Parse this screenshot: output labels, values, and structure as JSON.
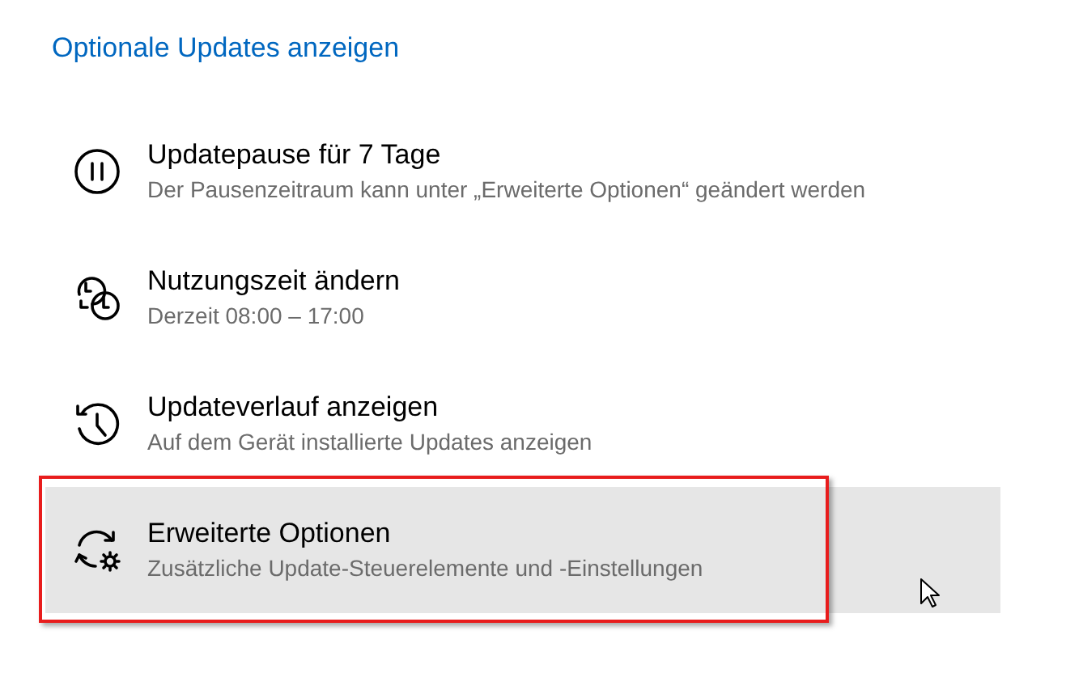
{
  "link": "Optionale Updates anzeigen",
  "items": [
    {
      "kind": "pause",
      "title": "Updatepause für 7 Tage",
      "subtitle": "Der Pausenzeitraum kann unter „Erweiterte Optionen“ geändert werden",
      "highlighted": false,
      "outlined": false
    },
    {
      "kind": "clock",
      "title": "Nutzungszeit ändern",
      "subtitle": "Derzeit 08:00 – 17:00",
      "highlighted": false,
      "outlined": false
    },
    {
      "kind": "history",
      "title": "Updateverlauf anzeigen",
      "subtitle": "Auf dem Gerät installierte Updates anzeigen",
      "highlighted": false,
      "outlined": false
    },
    {
      "kind": "sync",
      "title": "Erweiterte Optionen",
      "subtitle": "Zusätzliche Update-Steuerelemente und -Einstellungen",
      "highlighted": true,
      "outlined": true
    }
  ]
}
